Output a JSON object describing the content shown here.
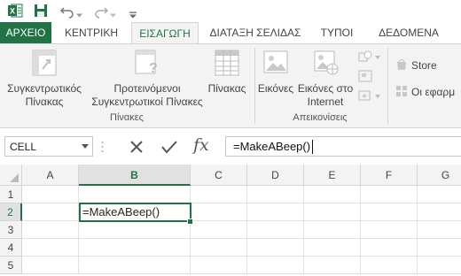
{
  "quick_access": {
    "icons": [
      "excel-logo-icon",
      "save-icon",
      "undo-icon",
      "undo-dropdown-icon",
      "redo-icon",
      "redo-dropdown-icon",
      "customize-qat-icon"
    ]
  },
  "tabs": [
    {
      "label": "ΑΡΧΕΙΟ",
      "state": "file"
    },
    {
      "label": "ΚΕΝΤΡΙΚΗ",
      "state": "normal"
    },
    {
      "label": "ΕΙΣΑΓΩΓΗ",
      "state": "active"
    },
    {
      "label": "ΔΙΑΤΑΞΗ ΣΕΛΙΔΑΣ",
      "state": "normal"
    },
    {
      "label": "ΤΥΠΟΙ",
      "state": "normal"
    },
    {
      "label": "ΔΕΔΟΜΕΝΑ",
      "state": "normal"
    }
  ],
  "ribbon": {
    "pivot_table": [
      "Συγκεντρωτικός",
      "Πίνακας"
    ],
    "recommended_pivot": [
      "Προτεινόμενοι",
      "Συγκεντρωτικοί Πίνακες"
    ],
    "table": "Πίνακας",
    "group_tables": "Πίνακες",
    "pictures": "Εικόνες",
    "online_pictures": [
      "Εικόνες στο",
      "Internet"
    ],
    "group_illustrations": "Απεικονίσεις",
    "store": "Store",
    "my_apps": "Οι εφαρμ"
  },
  "formula_bar": {
    "name_box": "CELL",
    "cancel_icon": "cancel-icon",
    "enter_icon": "check-icon",
    "fx_label": "fx",
    "formula": "=MakeABeep()"
  },
  "sheet": {
    "columns": [
      "A",
      "B",
      "C",
      "D",
      "E",
      "F",
      "G"
    ],
    "rows": [
      "1",
      "2",
      "3",
      "4",
      "5"
    ],
    "selected_column": "B",
    "selected_row": "2",
    "active_cell_value": "=MakeABeep()"
  },
  "colors": {
    "accent": "#217346",
    "ribbon_bg": "#f3f3f3",
    "header_bg": "#f3f3f3"
  }
}
